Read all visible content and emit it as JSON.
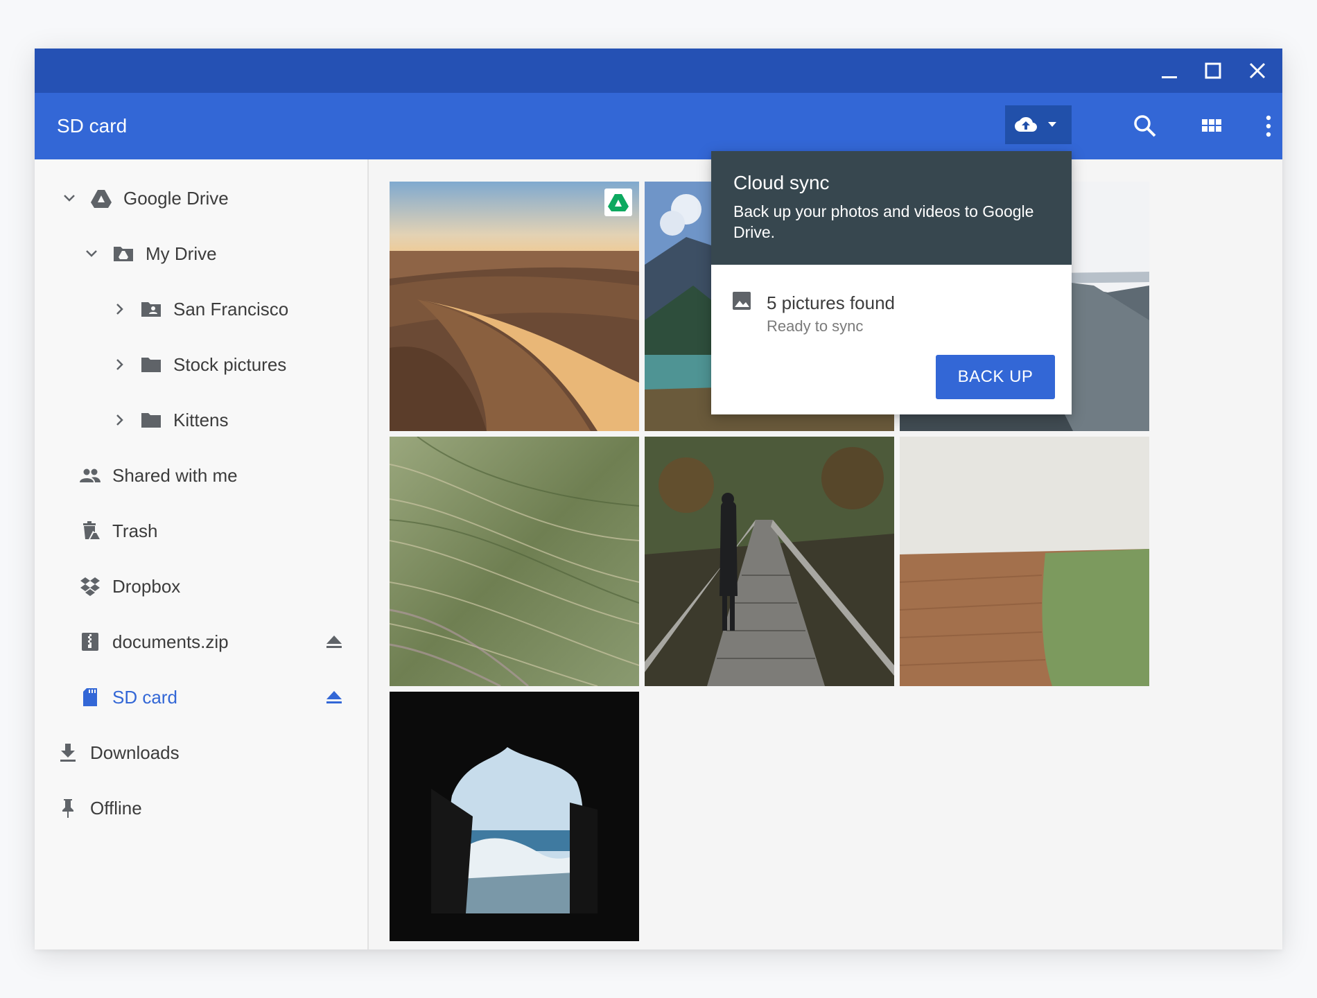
{
  "app": {
    "title": "SD card"
  },
  "titlebar": {
    "buttons": [
      "minimize-icon",
      "maximize-icon",
      "close-icon"
    ]
  },
  "toolbar": {
    "icons": [
      "cloud-upload-icon",
      "search-icon",
      "grid-view-icon",
      "more-vert-icon"
    ]
  },
  "sidebar": {
    "items": [
      {
        "label": "Google Drive",
        "icon": "google-drive-icon"
      },
      {
        "label": "My Drive",
        "icon": "drive-folder-icon"
      },
      {
        "label": "San Francisco",
        "icon": "shared-folder-icon"
      },
      {
        "label": "Stock pictures",
        "icon": "folder-icon"
      },
      {
        "label": "Kittens",
        "icon": "folder-icon"
      },
      {
        "label": "Shared with me",
        "icon": "people-icon"
      },
      {
        "label": "Trash",
        "icon": "trash-icon"
      },
      {
        "label": "Dropbox",
        "icon": "dropbox-icon"
      },
      {
        "label": "documents.zip",
        "icon": "zip-icon"
      },
      {
        "label": "SD card",
        "icon": "sd-card-icon"
      },
      {
        "label": "Downloads",
        "icon": "download-icon"
      },
      {
        "label": "Offline",
        "icon": "pin-icon"
      }
    ]
  },
  "popup": {
    "title": "Cloud sync",
    "description": "Back up your photos and videos to Google Drive.",
    "status": "5 pictures found",
    "substatus": "Ready to sync",
    "button": "BACK UP"
  },
  "colors": {
    "titlebar": "#2551b4",
    "appbar": "#3367d6",
    "accent": "#3367d6",
    "popup_header": "#37474f"
  },
  "photos": [
    "desert dunes",
    "mountain lake",
    "cliff valley",
    "grass field",
    "suspension bridge",
    "plowed field",
    "sea cave"
  ]
}
